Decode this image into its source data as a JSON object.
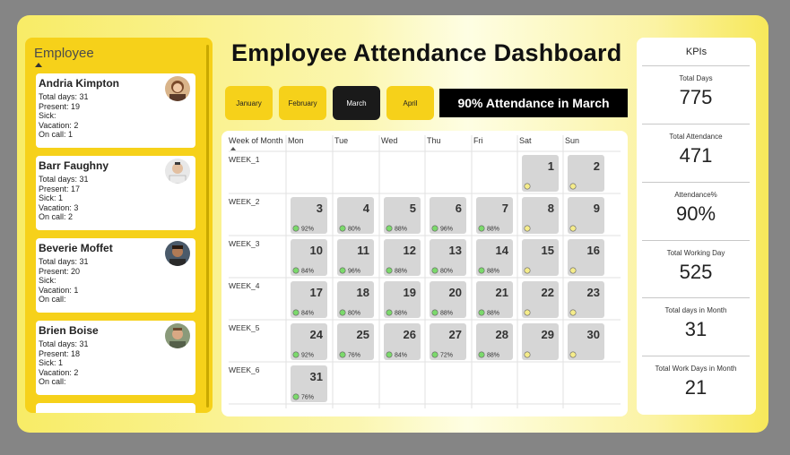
{
  "dashboard": {
    "title": "Employee Attendance Dashboard",
    "banner": "90% Attendance in March"
  },
  "months": [
    "January",
    "February",
    "March",
    "April"
  ],
  "selected_month": "March",
  "employee_panel": {
    "title": "Employee",
    "employees": [
      {
        "name": "Andria Kimpton",
        "total_days": "Total days: 31",
        "present": "Present: 19",
        "sick": "Sick:",
        "vacation": "Vacation: 2",
        "on_call": "On call: 1"
      },
      {
        "name": "Barr Faughny",
        "total_days": "Total days: 31",
        "present": "Present: 17",
        "sick": "Sick: 1",
        "vacation": "Vacation: 3",
        "on_call": "On call: 2"
      },
      {
        "name": "Beverie Moffet",
        "total_days": "Total days: 31",
        "present": "Present: 20",
        "sick": "Sick:",
        "vacation": "Vacation: 1",
        "on_call": "On call:"
      },
      {
        "name": "Brien Boise",
        "total_days": "Total days: 31",
        "present": "Present: 18",
        "sick": "Sick: 1",
        "vacation": "Vacation: 2",
        "on_call": "On call:"
      }
    ]
  },
  "calendar": {
    "header": [
      "Week of Month",
      "Mon",
      "Tue",
      "Wed",
      "Thu",
      "Fri",
      "Sat",
      "Sun"
    ],
    "weeks": [
      {
        "label": "WEEK_1",
        "days": [
          null,
          null,
          null,
          null,
          null,
          {
            "d": "1",
            "p": "",
            "c": "yellow"
          },
          {
            "d": "2",
            "p": "",
            "c": "yellow"
          }
        ]
      },
      {
        "label": "WEEK_2",
        "days": [
          {
            "d": "3",
            "p": "92%",
            "c": "green"
          },
          {
            "d": "4",
            "p": "80%",
            "c": "green"
          },
          {
            "d": "5",
            "p": "88%",
            "c": "green"
          },
          {
            "d": "6",
            "p": "96%",
            "c": "green"
          },
          {
            "d": "7",
            "p": "88%",
            "c": "green"
          },
          {
            "d": "8",
            "p": "",
            "c": "yellow"
          },
          {
            "d": "9",
            "p": "",
            "c": "yellow"
          }
        ]
      },
      {
        "label": "WEEK_3",
        "days": [
          {
            "d": "10",
            "p": "84%",
            "c": "green"
          },
          {
            "d": "11",
            "p": "96%",
            "c": "green"
          },
          {
            "d": "12",
            "p": "88%",
            "c": "green"
          },
          {
            "d": "13",
            "p": "80%",
            "c": "green"
          },
          {
            "d": "14",
            "p": "88%",
            "c": "green"
          },
          {
            "d": "15",
            "p": "",
            "c": "yellow"
          },
          {
            "d": "16",
            "p": "",
            "c": "yellow"
          }
        ]
      },
      {
        "label": "WEEK_4",
        "days": [
          {
            "d": "17",
            "p": "84%",
            "c": "green"
          },
          {
            "d": "18",
            "p": "80%",
            "c": "green"
          },
          {
            "d": "19",
            "p": "88%",
            "c": "green"
          },
          {
            "d": "20",
            "p": "88%",
            "c": "green"
          },
          {
            "d": "21",
            "p": "88%",
            "c": "green"
          },
          {
            "d": "22",
            "p": "",
            "c": "yellow"
          },
          {
            "d": "23",
            "p": "",
            "c": "yellow"
          }
        ]
      },
      {
        "label": "WEEK_5",
        "days": [
          {
            "d": "24",
            "p": "92%",
            "c": "green"
          },
          {
            "d": "25",
            "p": "76%",
            "c": "green"
          },
          {
            "d": "26",
            "p": "84%",
            "c": "green"
          },
          {
            "d": "27",
            "p": "72%",
            "c": "green"
          },
          {
            "d": "28",
            "p": "88%",
            "c": "green"
          },
          {
            "d": "29",
            "p": "",
            "c": "yellow"
          },
          {
            "d": "30",
            "p": "",
            "c": "yellow"
          }
        ]
      },
      {
        "label": "WEEK_6",
        "days": [
          {
            "d": "31",
            "p": "76%",
            "c": "green"
          },
          null,
          null,
          null,
          null,
          null,
          null
        ]
      }
    ]
  },
  "kpis": {
    "title": "KPIs",
    "items": [
      {
        "label": "Total Days",
        "value": "775"
      },
      {
        "label": "Total Attendance",
        "value": "471"
      },
      {
        "label": "Attendance%",
        "value": "90%"
      },
      {
        "label": "Total Working Day",
        "value": "525"
      },
      {
        "label": "Total days in Month",
        "value": "31"
      },
      {
        "label": "Total Work Days in Month",
        "value": "21"
      }
    ]
  },
  "colors": {
    "accent_yellow": "#f6d11a",
    "indicator_green": "#7bd96b",
    "indicator_yellow": "#f5ec8a",
    "selected_month": "#1a1a1a"
  }
}
